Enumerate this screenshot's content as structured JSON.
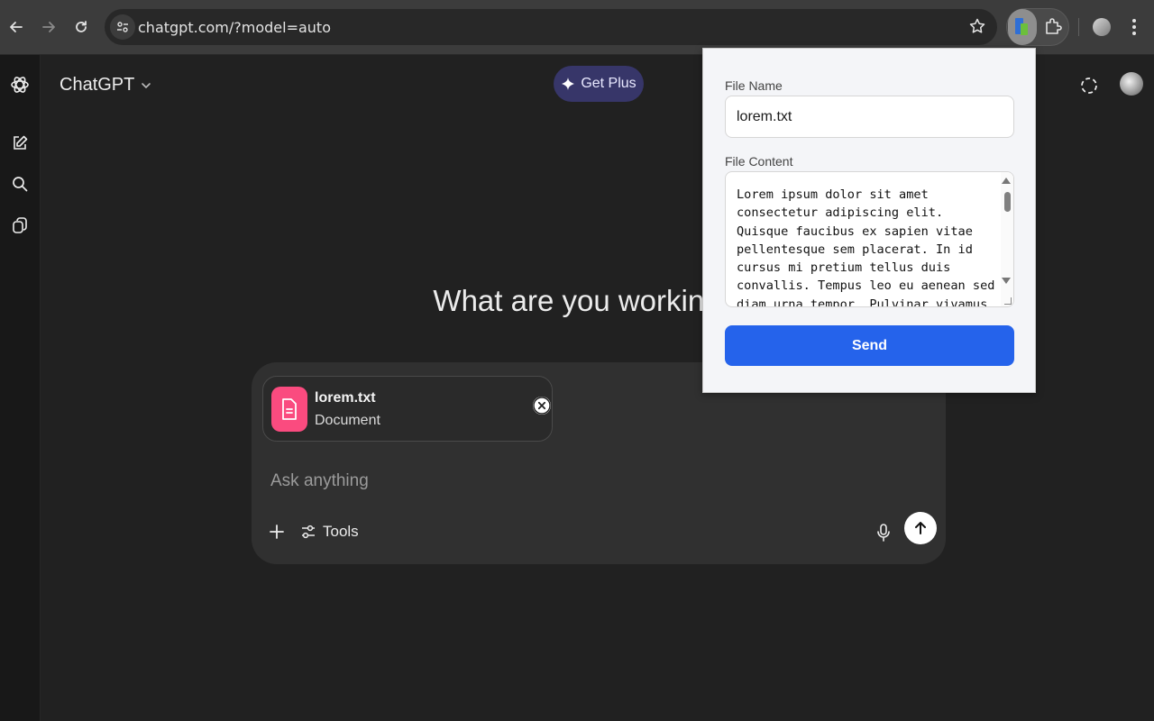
{
  "browser": {
    "url": "chatgpt.com/?model=auto",
    "icons": [
      "back-icon",
      "forward-icon",
      "reload-icon",
      "site-info-icon",
      "bookmark-star-icon",
      "extension-icon",
      "puzzle-icon",
      "profile-icon",
      "kebab-menu-icon"
    ]
  },
  "sidebar": {
    "icons": [
      "openai-logo-icon",
      "new-chat-icon",
      "search-icon",
      "library-icon"
    ]
  },
  "header": {
    "app_title": "ChatGPT",
    "get_plus_label": "Get Plus",
    "icons": [
      "temporary-chat-icon",
      "avatar"
    ]
  },
  "main": {
    "hero_text": "What are you working"
  },
  "composer": {
    "attachment": {
      "name": "lorem.txt",
      "type": "Document"
    },
    "placeholder": "Ask anything",
    "tools_label": "Tools"
  },
  "popup": {
    "file_name_label": "File Name",
    "file_name_value": "lorem.txt",
    "file_content_label": "File Content",
    "file_content_value": "Lorem ipsum dolor sit amet consectetur adipiscing elit. Quisque faucibus ex sapien vitae pellentesque sem placerat. In id cursus mi pretium tellus duis convallis. Tempus leo eu aenean sed diam urna tempor. Pulvinar vivamus",
    "send_label": "Send"
  },
  "colors": {
    "background": "#212121",
    "composer": "#303030",
    "get_plus_bg": "#373669",
    "file_icon_bg": "#fa4b7f",
    "send_button": "#2563eb"
  }
}
